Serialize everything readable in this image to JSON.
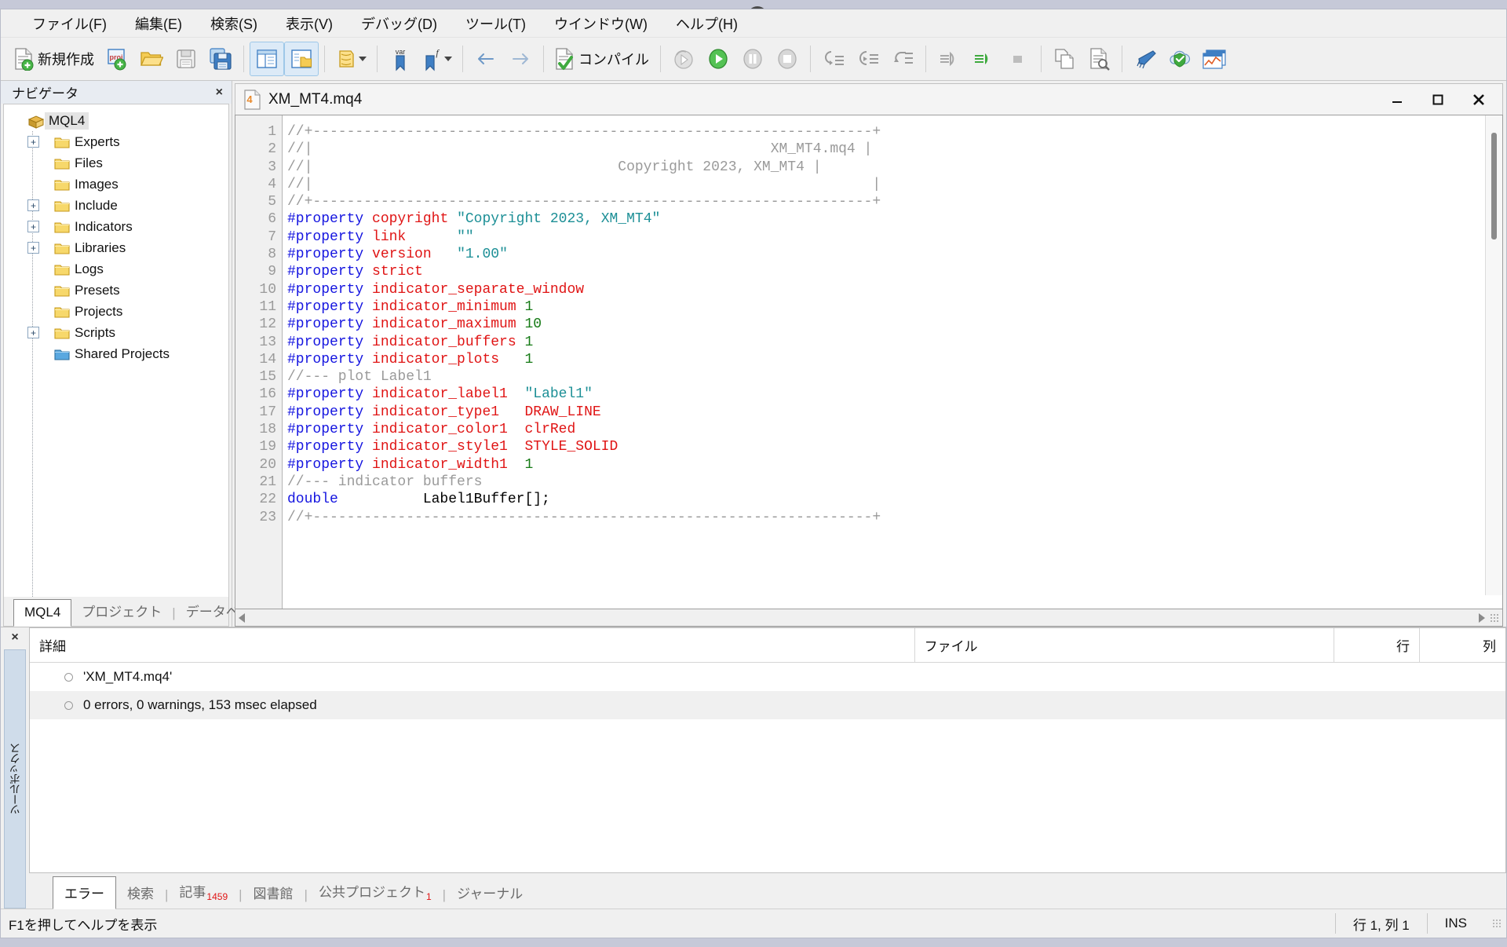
{
  "window": {
    "document_title": "XM_MT4.mq4",
    "minimize_label": "–",
    "maximize_label": "□",
    "close_label": "✕"
  },
  "menubar": {
    "items": [
      {
        "label": "ファイル(F)",
        "name": "menu-file"
      },
      {
        "label": "編集(E)",
        "name": "menu-edit"
      },
      {
        "label": "検索(S)",
        "name": "menu-search"
      },
      {
        "label": "表示(V)",
        "name": "menu-view"
      },
      {
        "label": "デバッグ(D)",
        "name": "menu-debug"
      },
      {
        "label": "ツール(T)",
        "name": "menu-tools"
      },
      {
        "label": "ウインドウ(W)",
        "name": "menu-window"
      },
      {
        "label": "ヘルプ(H)",
        "name": "menu-help"
      }
    ]
  },
  "toolbar": {
    "new_label": "新規作成",
    "compile_label": "コンパイル",
    "icons": [
      "new-file-icon",
      "new-project-icon",
      "open-folder-icon",
      "save-icon",
      "save-all-icon",
      "navigator-toggle-icon",
      "toolbox-toggle-icon",
      "properties-icon",
      "properties-dropdown-caret",
      "bookmark-var-icon",
      "bookmark-function-icon",
      "bookmark-dropdown-caret",
      "back-arrow-icon",
      "forward-arrow-icon",
      "compile-icon",
      "restart-debug-icon",
      "start-debug-icon",
      "pause-debug-icon",
      "stop-debug-icon",
      "step-into-icon",
      "step-over-icon",
      "step-out-icon",
      "run-to-cursor-icon",
      "continue-icon",
      "stop-profiling-icon",
      "copy-icon",
      "find-in-files-icon",
      "style-icon",
      "mql5-cloud-icon",
      "charts-icon"
    ]
  },
  "navigator": {
    "title": "ナビゲータ",
    "close_label": "×",
    "root": {
      "label": "MQL4",
      "icon": "mql4-package-icon",
      "selected": true
    },
    "items": [
      {
        "label": "Experts",
        "expandable": true,
        "icon": "folder-icon"
      },
      {
        "label": "Files",
        "expandable": false,
        "icon": "folder-icon"
      },
      {
        "label": "Images",
        "expandable": false,
        "icon": "folder-icon"
      },
      {
        "label": "Include",
        "expandable": true,
        "icon": "folder-icon"
      },
      {
        "label": "Indicators",
        "expandable": true,
        "icon": "folder-icon"
      },
      {
        "label": "Libraries",
        "expandable": true,
        "icon": "folder-icon"
      },
      {
        "label": "Logs",
        "expandable": false,
        "icon": "folder-icon"
      },
      {
        "label": "Presets",
        "expandable": false,
        "icon": "folder-icon"
      },
      {
        "label": "Projects",
        "expandable": false,
        "icon": "folder-icon"
      },
      {
        "label": "Scripts",
        "expandable": true,
        "icon": "folder-icon"
      },
      {
        "label": "Shared Projects",
        "expandable": false,
        "icon": "shared-folder-icon"
      }
    ],
    "tabs": [
      {
        "label": "MQL4",
        "active": true
      },
      {
        "label": "プロジェクト",
        "active": false
      },
      {
        "label": "データベース",
        "active": false
      }
    ]
  },
  "editor": {
    "first_line": 1,
    "lines": [
      {
        "n": 1,
        "tokens": [
          {
            "t": "//+------------------------------------------------------------------+",
            "c": "c-cm"
          }
        ]
      },
      {
        "n": 2,
        "tokens": [
          {
            "t": "//|                                                      XM_MT4.mq4 |",
            "c": "c-cm"
          }
        ]
      },
      {
        "n": 3,
        "tokens": [
          {
            "t": "//|                                    Copyright 2023, XM_MT4 |",
            "c": "c-cm"
          }
        ]
      },
      {
        "n": 4,
        "tokens": [
          {
            "t": "//|                                                                  |",
            "c": "c-cm"
          }
        ]
      },
      {
        "n": 5,
        "tokens": [
          {
            "t": "//+------------------------------------------------------------------+",
            "c": "c-cm"
          }
        ]
      },
      {
        "n": 6,
        "tokens": [
          {
            "t": "#property ",
            "c": "c-pp"
          },
          {
            "t": "copyright ",
            "c": "c-id"
          },
          {
            "t": "\"Copyright 2023, XM_MT4\"",
            "c": "c-str"
          }
        ]
      },
      {
        "n": 7,
        "tokens": [
          {
            "t": "#property ",
            "c": "c-pp"
          },
          {
            "t": "link      ",
            "c": "c-id"
          },
          {
            "t": "\"\"",
            "c": "c-str"
          }
        ]
      },
      {
        "n": 8,
        "tokens": [
          {
            "t": "#property ",
            "c": "c-pp"
          },
          {
            "t": "version   ",
            "c": "c-id"
          },
          {
            "t": "\"1.00\"",
            "c": "c-str"
          }
        ]
      },
      {
        "n": 9,
        "tokens": [
          {
            "t": "#property ",
            "c": "c-pp"
          },
          {
            "t": "strict",
            "c": "c-id"
          }
        ]
      },
      {
        "n": 10,
        "tokens": [
          {
            "t": "#property ",
            "c": "c-pp"
          },
          {
            "t": "indicator_separate_window",
            "c": "c-id"
          }
        ]
      },
      {
        "n": 11,
        "tokens": [
          {
            "t": "#property ",
            "c": "c-pp"
          },
          {
            "t": "indicator_minimum ",
            "c": "c-id"
          },
          {
            "t": "1",
            "c": "c-num"
          }
        ]
      },
      {
        "n": 12,
        "tokens": [
          {
            "t": "#property ",
            "c": "c-pp"
          },
          {
            "t": "indicator_maximum ",
            "c": "c-id"
          },
          {
            "t": "10",
            "c": "c-num"
          }
        ]
      },
      {
        "n": 13,
        "tokens": [
          {
            "t": "#property ",
            "c": "c-pp"
          },
          {
            "t": "indicator_buffers ",
            "c": "c-id"
          },
          {
            "t": "1",
            "c": "c-num"
          }
        ]
      },
      {
        "n": 14,
        "tokens": [
          {
            "t": "#property ",
            "c": "c-pp"
          },
          {
            "t": "indicator_plots   ",
            "c": "c-id"
          },
          {
            "t": "1",
            "c": "c-num"
          }
        ]
      },
      {
        "n": 15,
        "tokens": [
          {
            "t": "//--- plot Label1",
            "c": "c-cm"
          }
        ]
      },
      {
        "n": 16,
        "tokens": [
          {
            "t": "#property ",
            "c": "c-pp"
          },
          {
            "t": "indicator_label1  ",
            "c": "c-id"
          },
          {
            "t": "\"Label1\"",
            "c": "c-str"
          }
        ]
      },
      {
        "n": 17,
        "tokens": [
          {
            "t": "#property ",
            "c": "c-pp"
          },
          {
            "t": "indicator_type1   ",
            "c": "c-id"
          },
          {
            "t": "DRAW_LINE",
            "c": "c-id"
          }
        ]
      },
      {
        "n": 18,
        "tokens": [
          {
            "t": "#property ",
            "c": "c-pp"
          },
          {
            "t": "indicator_color1  ",
            "c": "c-id"
          },
          {
            "t": "clrRed",
            "c": "c-id"
          }
        ]
      },
      {
        "n": 19,
        "tokens": [
          {
            "t": "#property ",
            "c": "c-pp"
          },
          {
            "t": "indicator_style1  ",
            "c": "c-id"
          },
          {
            "t": "STYLE_SOLID",
            "c": "c-id"
          }
        ]
      },
      {
        "n": 20,
        "tokens": [
          {
            "t": "#property ",
            "c": "c-pp"
          },
          {
            "t": "indicator_width1  ",
            "c": "c-id"
          },
          {
            "t": "1",
            "c": "c-num"
          }
        ]
      },
      {
        "n": 21,
        "tokens": [
          {
            "t": "//--- indicator buffers",
            "c": "c-cm"
          }
        ]
      },
      {
        "n": 22,
        "tokens": [
          {
            "t": "double",
            "c": "c-kw"
          },
          {
            "t": "          Label1Buffer[];",
            "c": "c-pl"
          }
        ]
      },
      {
        "n": 23,
        "tokens": [
          {
            "t": "//+------------------------------------------------------------------+",
            "c": "c-cm"
          }
        ]
      }
    ]
  },
  "toolbox": {
    "close_label": "×",
    "vertical_label": "ツールボックス",
    "columns": [
      {
        "label": "詳細",
        "name": "column-detail"
      },
      {
        "label": "ファイル",
        "name": "column-file"
      },
      {
        "label": "行",
        "name": "column-line"
      },
      {
        "label": "列",
        "name": "column-column"
      }
    ],
    "rows": [
      {
        "detail": "'XM_MT4.mq4'",
        "file": "",
        "line": "",
        "col": ""
      },
      {
        "detail": "0 errors, 0 warnings, 153 msec elapsed",
        "file": "",
        "line": "",
        "col": ""
      }
    ],
    "tabs": [
      {
        "label": "エラー",
        "badge": "",
        "active": true
      },
      {
        "label": "検索",
        "badge": "",
        "active": false
      },
      {
        "label": "記事",
        "badge": "1459",
        "active": false
      },
      {
        "label": "図書館",
        "badge": "",
        "active": false
      },
      {
        "label": "公共プロジェクト",
        "badge": "1",
        "active": false
      },
      {
        "label": "ジャーナル",
        "badge": "",
        "active": false
      }
    ]
  },
  "statusbar": {
    "hint": "F1を押してヘルプを表示",
    "position": "行 1, 列 1",
    "mode": "INS"
  },
  "colors": {
    "accent": "#dceaf7",
    "comment": "#9a9a9a",
    "preprocessor": "#1515e0",
    "identifier": "#e01515",
    "string": "#1c8f96",
    "number": "#157a15",
    "badge": "#e01515"
  }
}
